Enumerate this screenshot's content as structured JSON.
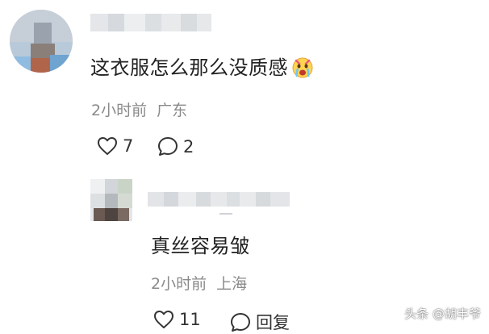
{
  "comments": [
    {
      "text": "这衣服怎么那么没质感",
      "emoji_icon": "crying-face-emoji",
      "time": "2小时前",
      "location": "广东",
      "likes": "7",
      "replies": "2"
    },
    {
      "text": "真丝容易皱",
      "time": "2小时前",
      "location": "上海",
      "likes": "11",
      "reply_label": "回复"
    }
  ],
  "watermark": {
    "text": "头条 @胡丰爷"
  },
  "icons": {
    "like": "heart-outline-icon",
    "reply": "speech-bubble-icon"
  },
  "colors": {
    "text": "#222222",
    "meta": "#8a8a8a",
    "background": "#ffffff"
  }
}
